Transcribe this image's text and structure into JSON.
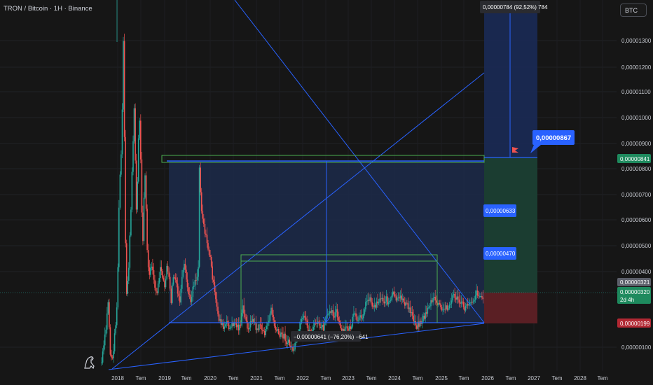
{
  "header": {
    "symbol_title": "TRON / Bitcoin · 1H · Binance"
  },
  "toolbar": {
    "currency_label": "BTC"
  },
  "colors": {
    "background": "#161616",
    "grid": "#222326",
    "up_candle": "#26a69a",
    "down_candle": "#ef5350",
    "drawing_blue": "#2962ff",
    "rectangle_fill": "#1c2a4a",
    "box_green": "#4caf50",
    "profit_zone": "#1b3d31",
    "loss_zone": "#5a1f24",
    "label_blue": "#2962ff",
    "label_green": "#1e8a5e",
    "label_red": "#b22833",
    "label_gray": "#5d606b"
  },
  "icons": {
    "logo": "tradingview-dino-icon",
    "flag": "red-flag-icon"
  },
  "chart_data": {
    "type": "candlestick",
    "title": "TRON / Bitcoin · 1H · Binance",
    "price_axis": {
      "scale": "linear",
      "range": [
        5e-07,
        1.4e-06
      ],
      "ticks": [
        "0,00001300",
        "0,00001200",
        "0,00001100",
        "0,00001000",
        "0,00000900",
        "0,00000800",
        "0,00000700",
        "0,00000600",
        "0,00000500",
        "0,00000400",
        "0,00000100"
      ],
      "tick_values": [
        1.3e-05,
        1.2e-05,
        1.1e-05,
        1e-05,
        9e-06,
        8e-06,
        7e-06,
        6e-06,
        5e-06,
        4e-06,
        1e-06
      ]
    },
    "time_axis": {
      "ticks": [
        "2018",
        "Tem",
        "2019",
        "Tem",
        "2020",
        "Tem",
        "2021",
        "Tem",
        "2022",
        "Tem",
        "2023",
        "Tem",
        "2024",
        "Tem",
        "2025",
        "Tem",
        "2026",
        "Tem",
        "2027",
        "Tem",
        "2028",
        "Tem"
      ]
    },
    "price_series_outline": [
      [
        0,
        518
      ],
      [
        4,
        470
      ],
      [
        6,
        430
      ],
      [
        8,
        505
      ],
      [
        10,
        515
      ],
      [
        12,
        480
      ],
      [
        14,
        440
      ],
      [
        15,
        380
      ],
      [
        16,
        300
      ],
      [
        17,
        250
      ],
      [
        18,
        220
      ],
      [
        19,
        160
      ],
      [
        20,
        60
      ],
      [
        21,
        200
      ],
      [
        22,
        350
      ],
      [
        23,
        420
      ],
      [
        25,
        380
      ],
      [
        27,
        300
      ],
      [
        28,
        250
      ],
      [
        29,
        200
      ],
      [
        30,
        150
      ],
      [
        31,
        230
      ],
      [
        32,
        300
      ],
      [
        33,
        260
      ],
      [
        34,
        200
      ],
      [
        35,
        170
      ],
      [
        36,
        230
      ],
      [
        37,
        300
      ],
      [
        38,
        340
      ],
      [
        39,
        280
      ],
      [
        40,
        250
      ],
      [
        41,
        300
      ],
      [
        42,
        360
      ],
      [
        43,
        380
      ],
      [
        44,
        395
      ],
      [
        46,
        380
      ],
      [
        48,
        400
      ],
      [
        50,
        420
      ],
      [
        52,
        410
      ],
      [
        54,
        380
      ],
      [
        56,
        400
      ],
      [
        58,
        410
      ],
      [
        60,
        380
      ],
      [
        62,
        400
      ],
      [
        64,
        430
      ],
      [
        65,
        410
      ],
      [
        66,
        395
      ],
      [
        68,
        400
      ],
      [
        70,
        420
      ],
      [
        72,
        430
      ],
      [
        74,
        400
      ],
      [
        76,
        380
      ],
      [
        78,
        400
      ],
      [
        80,
        420
      ],
      [
        82,
        430
      ],
      [
        84,
        410
      ],
      [
        86,
        400
      ],
      [
        88,
        395
      ],
      [
        89,
        380
      ],
      [
        90,
        240
      ],
      [
        91,
        270
      ],
      [
        92,
        300
      ],
      [
        94,
        320
      ],
      [
        96,
        340
      ],
      [
        98,
        355
      ],
      [
        100,
        370
      ],
      [
        102,
        395
      ],
      [
        104,
        420
      ],
      [
        106,
        440
      ],
      [
        108,
        455
      ],
      [
        110,
        460
      ],
      [
        112,
        470
      ],
      [
        114,
        465
      ],
      [
        116,
        462
      ],
      [
        118,
        470
      ],
      [
        120,
        465
      ],
      [
        122,
        460
      ],
      [
        124,
        465
      ],
      [
        126,
        468
      ],
      [
        128,
        462
      ],
      [
        130,
        440
      ],
      [
        132,
        455
      ],
      [
        134,
        465
      ],
      [
        136,
        470
      ],
      [
        138,
        455
      ],
      [
        140,
        460
      ],
      [
        142,
        468
      ],
      [
        144,
        470
      ],
      [
        146,
        465
      ],
      [
        148,
        472
      ],
      [
        150,
        475
      ],
      [
        152,
        470
      ],
      [
        154,
        455
      ],
      [
        156,
        440
      ],
      [
        158,
        460
      ],
      [
        160,
        470
      ],
      [
        162,
        475
      ],
      [
        164,
        480
      ],
      [
        166,
        478
      ],
      [
        168,
        480
      ],
      [
        170,
        488
      ],
      [
        172,
        490
      ],
      [
        174,
        495
      ],
      [
        176,
        500
      ],
      [
        178,
        495
      ],
      [
        180,
        485
      ],
      [
        182,
        470
      ],
      [
        184,
        460
      ],
      [
        186,
        455
      ],
      [
        188,
        460
      ],
      [
        190,
        470
      ],
      [
        192,
        475
      ],
      [
        194,
        470
      ],
      [
        196,
        465
      ],
      [
        198,
        460
      ],
      [
        200,
        465
      ],
      [
        202,
        468
      ],
      [
        204,
        470
      ],
      [
        206,
        460
      ],
      [
        208,
        450
      ],
      [
        210,
        440
      ],
      [
        212,
        445
      ],
      [
        214,
        450
      ],
      [
        216,
        445
      ],
      [
        218,
        460
      ],
      [
        220,
        470
      ],
      [
        222,
        475
      ],
      [
        224,
        470
      ],
      [
        226,
        468
      ],
      [
        228,
        470
      ],
      [
        230,
        465
      ],
      [
        232,
        450
      ],
      [
        234,
        455
      ],
      [
        236,
        460
      ],
      [
        238,
        455
      ],
      [
        240,
        450
      ],
      [
        242,
        440
      ],
      [
        244,
        430
      ],
      [
        246,
        425
      ],
      [
        248,
        430
      ],
      [
        250,
        440
      ],
      [
        252,
        435
      ],
      [
        254,
        430
      ],
      [
        256,
        428
      ],
      [
        258,
        425
      ],
      [
        260,
        430
      ],
      [
        262,
        428
      ],
      [
        264,
        432
      ],
      [
        266,
        430
      ],
      [
        268,
        420
      ],
      [
        270,
        425
      ],
      [
        272,
        430
      ],
      [
        274,
        428
      ],
      [
        276,
        425
      ],
      [
        278,
        430
      ],
      [
        280,
        435
      ],
      [
        282,
        440
      ],
      [
        284,
        445
      ],
      [
        286,
        450
      ],
      [
        288,
        460
      ],
      [
        290,
        465
      ],
      [
        292,
        462
      ],
      [
        294,
        460
      ],
      [
        296,
        455
      ],
      [
        298,
        450
      ],
      [
        300,
        440
      ],
      [
        302,
        435
      ],
      [
        304,
        430
      ],
      [
        306,
        428
      ],
      [
        308,
        432
      ],
      [
        310,
        435
      ],
      [
        312,
        440
      ],
      [
        314,
        445
      ],
      [
        316,
        440
      ],
      [
        318,
        438
      ],
      [
        320,
        436
      ],
      [
        322,
        430
      ],
      [
        324,
        420
      ],
      [
        326,
        425
      ],
      [
        328,
        430
      ],
      [
        330,
        432
      ],
      [
        332,
        436
      ],
      [
        334,
        440
      ],
      [
        336,
        438
      ],
      [
        338,
        432
      ],
      [
        340,
        428
      ],
      [
        342,
        430
      ],
      [
        344,
        420
      ],
      [
        346,
        418
      ],
      [
        348,
        422
      ],
      [
        350,
        425
      ],
      [
        352,
        430
      ]
    ],
    "annotations": {
      "top_measure_label": "0,00000784 (92,52%) 784",
      "bottom_measure_label": "−0,00000641 (−76,20%) −641",
      "target_callout": "0,00000867",
      "mid_label_1": "0,00000633",
      "mid_label_2": "0,00000470",
      "level_tag": "0,00000841",
      "current_price": "0,00000321",
      "last_close": "0,00000320",
      "countdown": "2d 4h",
      "stop_tag": "0,00000199"
    }
  }
}
